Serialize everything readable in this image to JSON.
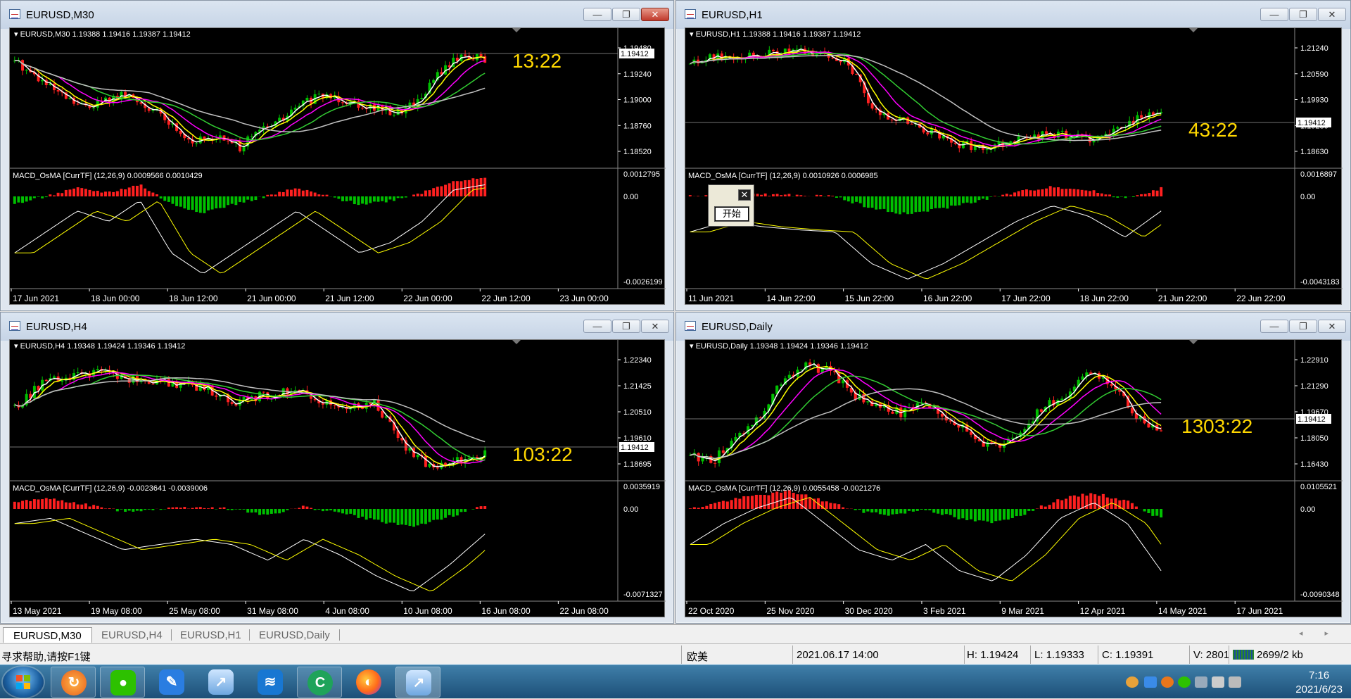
{
  "windows": [
    {
      "title": "EURUSD,M30",
      "active": true,
      "info": "EURUSD,M30  1.19388 1.19416 1.19387 1.19412",
      "price_axis": [
        "1.19480",
        "1.19240",
        "1.19000",
        "1.18760",
        "1.18520"
      ],
      "current_price": "1.19412",
      "timer": "13:22",
      "macd_label": "MACD_OsMA [CurrTF] (12,26,9) 0.0009566 0.0010429",
      "macd_axis": [
        "0.0012795",
        "0.00",
        "-0.0026199"
      ],
      "time_axis": [
        "17 Jun 2021",
        "18 Jun 00:00",
        "18 Jun 12:00",
        "21 Jun 00:00",
        "21 Jun 12:00",
        "22 Jun 00:00",
        "22 Jun 12:00",
        "23 Jun 00:00"
      ]
    },
    {
      "title": "EURUSD,H1",
      "active": false,
      "info": "EURUSD,H1  1.19388 1.19416 1.19387 1.19412",
      "price_axis": [
        "1.21240",
        "1.20590",
        "1.19930",
        "1.19280",
        "1.18630"
      ],
      "current_price": "1.19412",
      "timer": "43:22",
      "macd_label": "MACD_OsMA [CurrTF] (12,26,9) 0.0010926 0.0006985",
      "macd_axis": [
        "0.0016897",
        "0.00",
        "-0.0043183"
      ],
      "time_axis": [
        "11 Jun 2021",
        "14 Jun 22:00",
        "15 Jun 22:00",
        "16 Jun 22:00",
        "17 Jun 22:00",
        "18 Jun 22:00",
        "21 Jun 22:00",
        "22 Jun 22:00"
      ]
    },
    {
      "title": "EURUSD,H4",
      "active": false,
      "info": "EURUSD,H4  1.19348 1.19424 1.19346 1.19412",
      "price_axis": [
        "1.22340",
        "1.21425",
        "1.20510",
        "1.19610",
        "1.18695"
      ],
      "current_price": "1.19412",
      "timer": "103:22",
      "macd_label": "MACD_OsMA [CurrTF] (12,26,9) -0.0023641 -0.0039006",
      "macd_axis": [
        "0.0035919",
        "0.00",
        "-0.0071327"
      ],
      "time_axis": [
        "13 May 2021",
        "19 May 08:00",
        "25 May 08:00",
        "31 May 08:00",
        "4 Jun 08:00",
        "10 Jun 08:00",
        "16 Jun 08:00",
        "22 Jun 08:00"
      ]
    },
    {
      "title": "EURUSD,Daily",
      "active": false,
      "info": "EURUSD,Daily  1.19348 1.19424 1.19346 1.19412",
      "price_axis": [
        "1.22910",
        "1.21290",
        "1.19670",
        "1.18050",
        "1.16430"
      ],
      "current_price": "1.19412",
      "timer": "1303:22",
      "macd_label": "MACD_OsMA [CurrTF] (12,26,9) 0.0055458 -0.0021276",
      "macd_axis": [
        "0.0105521",
        "0.00",
        "-0.0090348"
      ],
      "time_axis": [
        "22 Oct 2020",
        "25 Nov 2020",
        "30 Dec 2020",
        "3 Feb 2021",
        "9 Mar 2021",
        "12 Apr 2021",
        "14 May 2021",
        "17 Jun 2021"
      ]
    }
  ],
  "dialog": {
    "button": "开始",
    "close": "✕"
  },
  "window_buttons": {
    "minimize": "—",
    "restore": "❐",
    "close": "✕"
  },
  "tabs": [
    "EURUSD,M30",
    "EURUSD,H4",
    "EURUSD,H1",
    "EURUSD,Daily"
  ],
  "tab_arrows": "◂ ▸",
  "status": {
    "help": "寻求帮助,请按F1键",
    "profile": "欧美",
    "datetime": "2021.06.17 14:00",
    "high": "H: 1.19424",
    "low": "L: 1.19333",
    "close": "C: 1.19391",
    "volume": "V: 2801",
    "traffic": "2699/2 kb"
  },
  "taskbar": {
    "apps": [
      "firefox-like-app",
      "wechat",
      "pen-app",
      "mt4-terminal",
      "meta-app",
      "green-app",
      "firefox",
      "mt4-terminal-active"
    ],
    "time": "7:16",
    "date": "2021/6/23"
  },
  "colors": {
    "timer": "#ffd700",
    "bull": "#00c000",
    "bear": "#ff2020",
    "ma_fast": "#ffffff",
    "ma_yellow": "#ffff00",
    "ma_magenta": "#ff00ff",
    "ma_green": "#32cd32",
    "ma_gray": "#c0c0c0"
  }
}
